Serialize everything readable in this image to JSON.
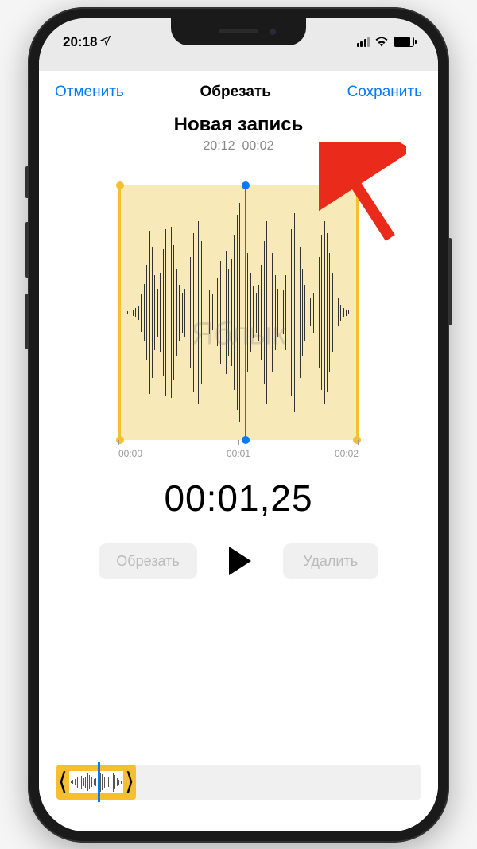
{
  "status_bar": {
    "time": "20:18",
    "location_icon": "location-arrow"
  },
  "header": {
    "cancel": "Отменить",
    "title": "Обрезать",
    "save": "Сохранить"
  },
  "recording": {
    "title": "Новая запись",
    "created_time": "20:12",
    "duration": "00:02"
  },
  "watermark": "Яблык",
  "timeline": {
    "labels": [
      "00:00",
      "00:01",
      "00:02"
    ]
  },
  "playback": {
    "current_time": "00:01,25"
  },
  "controls": {
    "trim": "Обрезать",
    "delete": "Удалить"
  },
  "colors": {
    "accent": "#007aff",
    "trim_handle": "#f5bf2f",
    "trim_fill": "#f8e9b8",
    "annotation": "#ea2a1a"
  }
}
